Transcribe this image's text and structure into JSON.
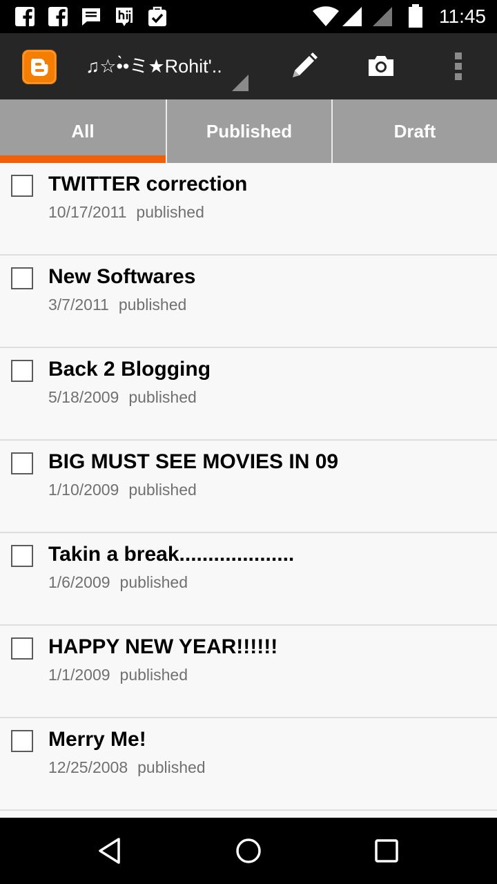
{
  "status_bar": {
    "time": "11:45",
    "notification_icons": [
      "facebook-icon",
      "facebook-icon",
      "message-icon",
      "hi-app-icon",
      "clipboard-check-icon"
    ],
    "system_icons": [
      "wifi-icon",
      "signal-icon",
      "signal-empty-icon",
      "battery-icon"
    ]
  },
  "app_bar": {
    "blog_title": "♫☆•̀•ミ★Rohit'..",
    "logo_icon": "blogger-logo-icon",
    "actions": [
      "edit-post-icon",
      "camera-icon",
      "overflow-menu-icon"
    ]
  },
  "tabs": [
    {
      "label": "All",
      "selected": true
    },
    {
      "label": "Published",
      "selected": false
    },
    {
      "label": "Draft",
      "selected": false
    }
  ],
  "posts": [
    {
      "title": "TWITTER correction",
      "date": "10/17/2011",
      "status": "published",
      "checked": false
    },
    {
      "title": "New Softwares",
      "date": "3/7/2011",
      "status": "published",
      "checked": false
    },
    {
      "title": "Back 2 Blogging",
      "date": "5/18/2009",
      "status": "published",
      "checked": false
    },
    {
      "title": "BIG MUST SEE MOVIES IN 09",
      "date": "1/10/2009",
      "status": "published",
      "checked": false
    },
    {
      "title": "Takin a break....................",
      "date": "1/6/2009",
      "status": "published",
      "checked": false
    },
    {
      "title": "HAPPY NEW YEAR!!!!!!",
      "date": "1/1/2009",
      "status": "published",
      "checked": false
    },
    {
      "title": "Merry Me!",
      "date": "12/25/2008",
      "status": "published",
      "checked": false
    }
  ],
  "nav_bar": [
    "back-icon",
    "home-icon",
    "recents-icon"
  ],
  "colors": {
    "accent": "#f25f0a",
    "app_bar": "#262626",
    "tab_bar": "#9e9e9e",
    "blogger_orange": "#f57d00"
  }
}
